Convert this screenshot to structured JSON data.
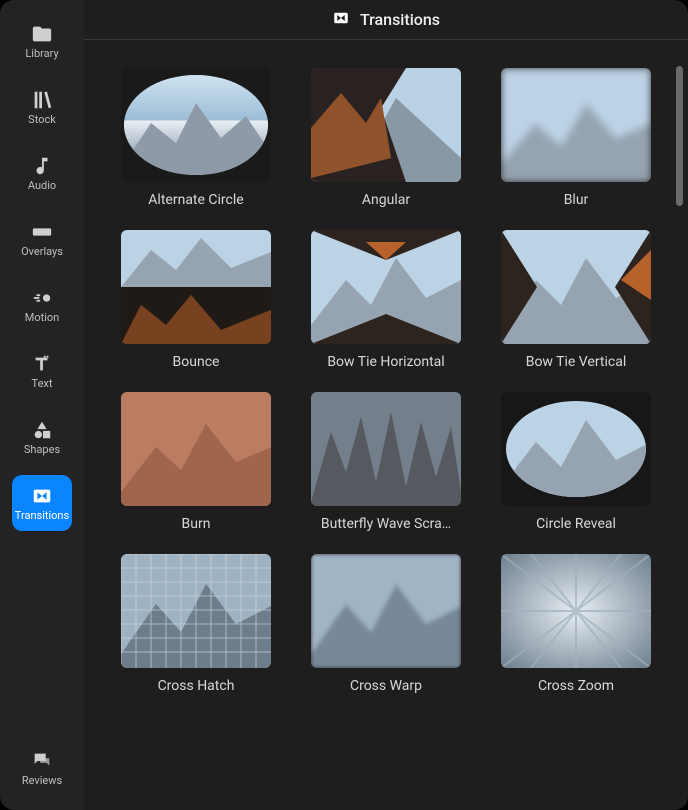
{
  "sidebar": {
    "items": [
      {
        "id": "library",
        "label": "Library"
      },
      {
        "id": "stock",
        "label": "Stock"
      },
      {
        "id": "audio",
        "label": "Audio"
      },
      {
        "id": "overlays",
        "label": "Overlays"
      },
      {
        "id": "motion",
        "label": "Motion"
      },
      {
        "id": "text",
        "label": "Text"
      },
      {
        "id": "shapes",
        "label": "Shapes"
      },
      {
        "id": "transitions",
        "label": "Transitions"
      }
    ],
    "footer": {
      "id": "reviews",
      "label": "Reviews"
    },
    "active": "transitions"
  },
  "header": {
    "title": "Transitions"
  },
  "transitions": [
    {
      "id": "alternate-circle",
      "label": "Alternate Circle"
    },
    {
      "id": "angular",
      "label": "Angular"
    },
    {
      "id": "blur",
      "label": "Blur"
    },
    {
      "id": "bounce",
      "label": "Bounce"
    },
    {
      "id": "bow-tie-horizontal",
      "label": "Bow Tie Horizontal"
    },
    {
      "id": "bow-tie-vertical",
      "label": "Bow Tie Vertical"
    },
    {
      "id": "burn",
      "label": "Burn"
    },
    {
      "id": "butterfly-wave-scrawler",
      "label": "Butterfly Wave Scra…"
    },
    {
      "id": "circle-reveal",
      "label": "Circle Reveal"
    },
    {
      "id": "cross-hatch",
      "label": "Cross Hatch"
    },
    {
      "id": "cross-warp",
      "label": "Cross Warp"
    },
    {
      "id": "cross-zoom",
      "label": "Cross Zoom"
    }
  ]
}
